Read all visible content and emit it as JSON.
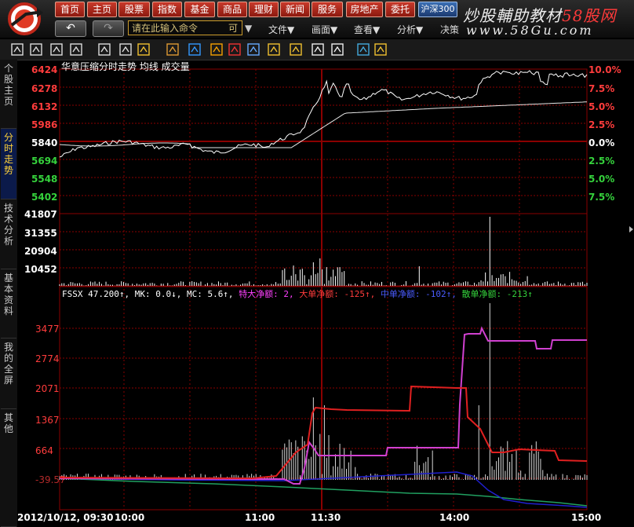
{
  "menu": {
    "buttons": [
      "首页",
      "主页",
      "股票",
      "指数",
      "基金",
      "商品",
      "理财",
      "新闻",
      "服务",
      "房地产",
      "委托"
    ],
    "market_tab": "沪深300",
    "command_placeholder": "请在此输入命令",
    "command_suffix": "可",
    "menus": [
      "文件▼",
      "画面▼",
      "查看▼",
      "分析▼",
      "决策"
    ]
  },
  "brand": {
    "line1_black": "炒股輔助教材",
    "line1_red": "58股网",
    "line2": "www.58Gu.com"
  },
  "toolbar_icons": [
    "grid-icon",
    "zoom-icon",
    "cross-icon",
    "bar-icon",
    "arrow-icon",
    "move-icon",
    "flag-icon",
    "dots-icon",
    "dots-icon",
    "bell-icon",
    "chart-icon",
    "chart-icon",
    "line-icon",
    "line-icon",
    "info-icon",
    "download-icon",
    "stack-icon",
    "diamond-icon"
  ],
  "left_tabs": [
    "个股主页",
    "分时走势",
    "技术分析",
    "基本资料",
    "我的全屏",
    "其他"
  ],
  "price_header": "华意压缩分时走势  均线  成交量",
  "price_axis_left": [
    "6424",
    "6278",
    "6132",
    "5986",
    "5840",
    "5694",
    "5548",
    "5402"
  ],
  "price_axis_right": [
    "10.0%",
    "7.5%",
    "5.0%",
    "2.5%",
    "0.0%",
    "2.5%",
    "5.0%",
    "7.5%"
  ],
  "volume_axis": [
    "41807",
    "31355",
    "20904",
    "10452"
  ],
  "indicator": {
    "name": "FSSX 47.200↑,",
    "mk": "MK: 0.0↓,",
    "mc": "MC: 5.6↑,",
    "t1": "特大净额: 2,",
    "t2": "大单净额: -125↑,",
    "t3": "中单净额: -",
    "t3v": "↑,",
    "t4": "散单净额: -213↑"
  },
  "indicator_axis": [
    "3477",
    "2774",
    "2071",
    "1367",
    "664",
    "-39.57"
  ],
  "indicator_axis_note": "-39.57 partially hidden behind lines",
  "time_axis": [
    "2012/10/12, 09:30",
    "10:00",
    "11:00",
    "11:30",
    "14:00",
    "15:00"
  ],
  "colors": {
    "price": "#ffffff",
    "avg": "#ffffff",
    "large_net": "#e02020",
    "super_net": "#d040d0",
    "mid_net": "#2020d0",
    "small_net": "#20a060",
    "grid": "#8a0000"
  }
}
